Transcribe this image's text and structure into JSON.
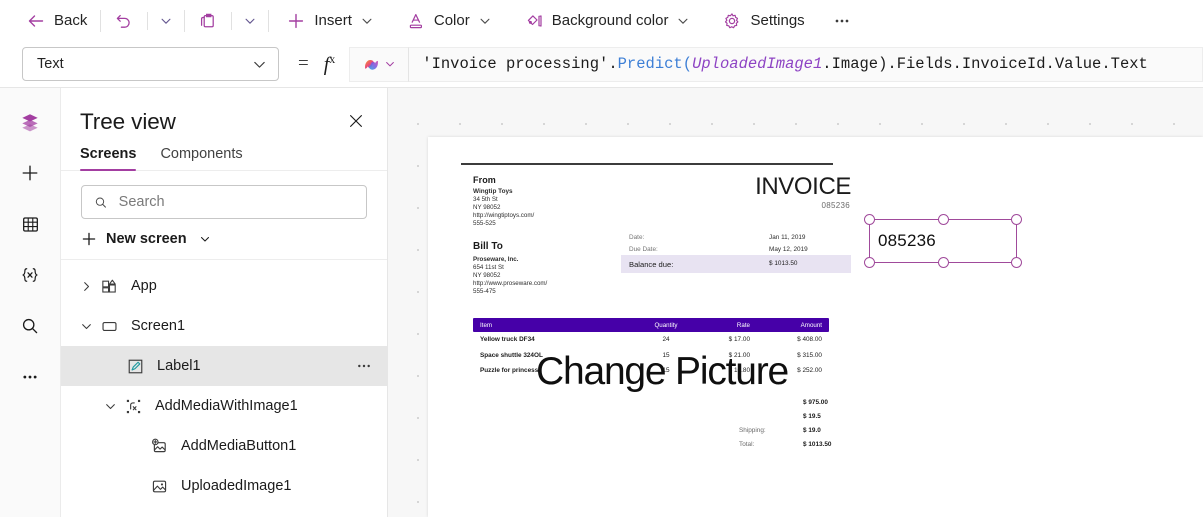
{
  "toolbar": {
    "back_label": "Back",
    "undo_icon": "undo-icon",
    "undo_chevron": "chevron-down-icon",
    "paste_icon": "paste-icon",
    "paste_chevron": "chevron-down-icon",
    "insert_label": "Insert",
    "color_label": "Color",
    "background_color_label": "Background color",
    "settings_label": "Settings",
    "overflow_label": "⋯",
    "accent": "#a33ea1"
  },
  "formula_bar": {
    "property": "Text",
    "equals": "=",
    "fx": "fx",
    "copilot_icon": "copilot-icon",
    "formula": {
      "part1": "'Invoice processing'",
      "part2": ".",
      "part3": "Predict",
      "part4": "(",
      "part5": "UploadedImage1",
      "part6": ".Image).Fields.InvoiceId.Value.Text"
    },
    "full_formula": "'Invoice processing'.Predict(UploadedImage1.Image).Fields.InvoiceId.Value.Text"
  },
  "rail": {
    "items": [
      {
        "name": "tree-view-icon",
        "selected": true
      },
      {
        "name": "insert-icon",
        "selected": false
      },
      {
        "name": "data-icon",
        "selected": false
      },
      {
        "name": "variables-icon",
        "selected": false
      },
      {
        "name": "search-icon",
        "selected": false
      },
      {
        "name": "more-icon",
        "selected": false
      }
    ]
  },
  "tree_view": {
    "title": "Tree view",
    "close_icon": "close-icon",
    "tabs": [
      {
        "label": "Screens",
        "active": true
      },
      {
        "label": "Components",
        "active": false
      }
    ],
    "search_placeholder": "Search",
    "search_value": "",
    "new_screen_label": "New screen",
    "nodes": [
      {
        "label": "App",
        "depth": 1,
        "twist": "collapsed",
        "icon": "app-icon",
        "selected": false,
        "overflow": false
      },
      {
        "label": "Screen1",
        "depth": 1,
        "twist": "expanded",
        "icon": "screen-icon",
        "selected": false,
        "overflow": false
      },
      {
        "label": "Label1",
        "depth": 2,
        "twist": "none",
        "icon": "label-icon",
        "selected": true,
        "overflow": true
      },
      {
        "label": "AddMediaWithImage1",
        "depth": 2,
        "twist": "expanded",
        "icon": "group-icon",
        "selected": false,
        "overflow": false
      },
      {
        "label": "AddMediaButton1",
        "depth": 3,
        "twist": "none",
        "icon": "add-media-icon",
        "selected": false,
        "overflow": false
      },
      {
        "label": "UploadedImage1",
        "depth": 3,
        "twist": "none",
        "icon": "image-icon",
        "selected": false,
        "overflow": false
      }
    ]
  },
  "canvas": {
    "change_picture_label": "Change Picture",
    "selected_control": {
      "text": "085236",
      "handle_color": "#a04a9b",
      "handles": [
        "top-left",
        "top-middle",
        "top-right",
        "bottom-left",
        "bottom-middle",
        "bottom-right"
      ]
    },
    "invoice": {
      "title": "INVOICE",
      "number": "085236",
      "from_heading": "From",
      "from": {
        "company": "Wingtip Toys",
        "street": "34 5th St",
        "city": "NY 98052",
        "url": "http://wingtiptoys.com/",
        "phone": "555-525"
      },
      "bill_to_heading": "Bill To",
      "bill_to": {
        "company": "Proseware, Inc.",
        "street": "654 11st St",
        "city": "NY 98052",
        "url": "http://www.proseware.com/",
        "phone": "555-475"
      },
      "meta": [
        {
          "key": "Date:",
          "value": "Jan 11, 2019",
          "highlight": false
        },
        {
          "key": "Due Date:",
          "value": "May 12, 2019",
          "highlight": false
        },
        {
          "key": "Balance due:",
          "value": "$ 1013.50",
          "highlight": true
        }
      ],
      "table": {
        "headers": [
          "Item",
          "Quantity",
          "Rate",
          "Amount"
        ],
        "header_bg": "#4600a8",
        "rows": [
          {
            "item": "Yellow truck DF34",
            "quantity": "24",
            "rate": "$ 17.00",
            "amount": "$ 408.00"
          },
          {
            "item": "Space shuttle 324OL",
            "quantity": "15",
            "rate": "$ 21.00",
            "amount": "$ 315.00"
          },
          {
            "item": "Puzzle for princess",
            "quantity": "15",
            "rate": "$ 16.80",
            "amount": "$ 252.00"
          }
        ]
      },
      "totals": [
        {
          "key": "",
          "value": "$ 975.00"
        },
        {
          "key": "",
          "value": "$ 19.5"
        },
        {
          "key": "Shipping:",
          "value": "$ 19.0"
        },
        {
          "key": "Total:",
          "value": "$ 1013.50"
        }
      ]
    }
  }
}
